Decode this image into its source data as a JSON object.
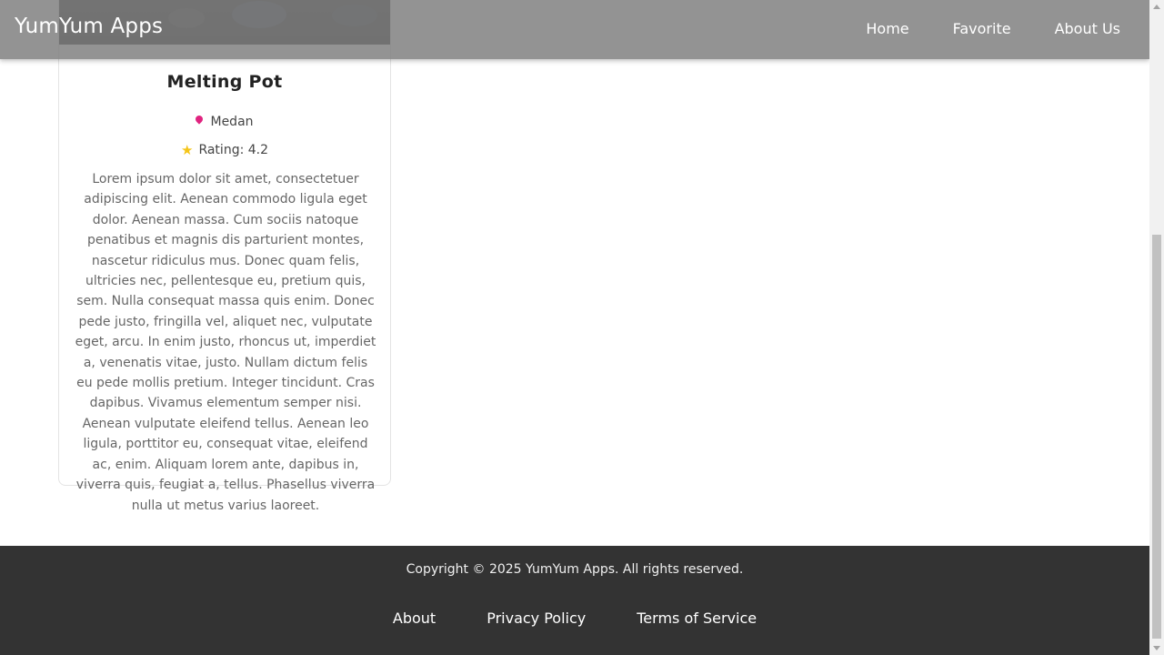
{
  "header": {
    "brand": "YumYum Apps",
    "nav": [
      "Home",
      "Favorite",
      "About Us"
    ]
  },
  "card": {
    "title": "Melting Pot",
    "location": "Medan",
    "rating_text": "Rating: 4.2",
    "description": "Lorem ipsum dolor sit amet, consectetuer adipiscing elit. Aenean commodo ligula eget dolor. Aenean massa. Cum sociis natoque penatibus et magnis dis parturient montes, nascetur ridiculus mus. Donec quam felis, ultricies nec, pellentesque eu, pretium quis, sem. Nulla consequat massa quis enim. Donec pede justo, fringilla vel, aliquet nec, vulputate eget, arcu. In enim justo, rhoncus ut, imperdiet a, venenatis vitae, justo. Nullam dictum felis eu pede mollis pretium. Integer tincidunt. Cras dapibus. Vivamus elementum semper nisi. Aenean vulputate eleifend tellus. Aenean leo ligula, porttitor eu, consequat vitae, eleifend ac, enim. Aliquam lorem ante, dapibus in, viverra quis, feugiat a, tellus. Phasellus viverra nulla ut metus varius laoreet."
  },
  "footer": {
    "copyright": "Copyright © 2025 YumYum Apps. All rights reserved.",
    "links": [
      "About",
      "Privacy Policy",
      "Terms of Service"
    ]
  },
  "icons": {
    "location": "map-pin-icon",
    "rating": "star-icon"
  },
  "colors": {
    "header_bg": "#808080",
    "footer_bg": "#333333",
    "pin": "#e0237f",
    "star": "#f5c518"
  }
}
